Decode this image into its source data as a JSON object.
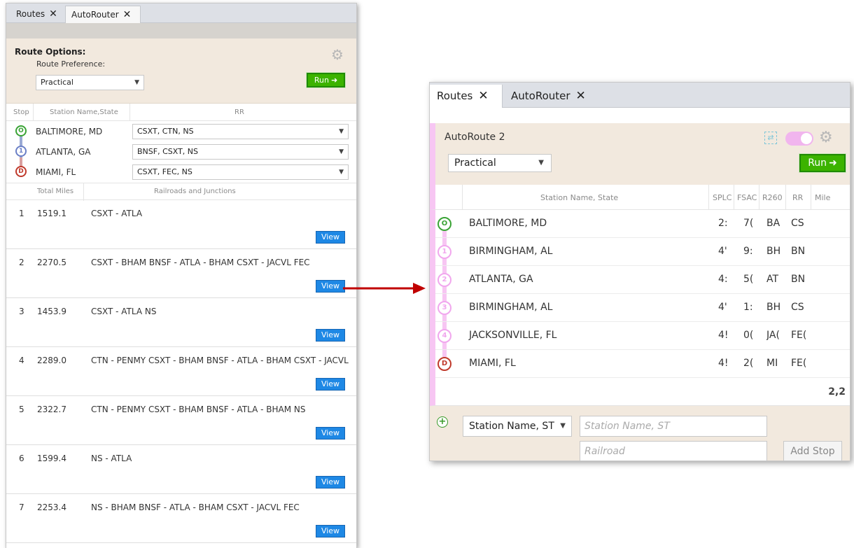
{
  "left": {
    "tabs": [
      {
        "label": "Routes",
        "close": "✕"
      },
      {
        "label": "AutoRouter",
        "close": "✕"
      }
    ],
    "options": {
      "title": "Route Options:",
      "pref_label": "Route Preference:",
      "pref_value": "Practical",
      "run_label": "Run"
    },
    "stop_headers": {
      "stop": "Stop",
      "station": "Station Name,State",
      "rr": "RR"
    },
    "stops": [
      {
        "marker": "O",
        "name": "BALTIMORE, MD",
        "rr": "CSXT, CTN, NS"
      },
      {
        "marker": "1",
        "name": "ATLANTA, GA",
        "rr": "BNSF, CSXT, NS"
      },
      {
        "marker": "D",
        "name": "MIAMI, FL",
        "rr": "CSXT, FEC, NS"
      }
    ],
    "result_headers": {
      "miles": "Total Miles",
      "rr": "Railroads and Junctions"
    },
    "view_label": "View",
    "results": [
      {
        "num": "1",
        "miles": "1519.1",
        "path": "CSXT - ATLA"
      },
      {
        "num": "2",
        "miles": "2270.5",
        "path": "CSXT - BHAM BNSF - ATLA - BHAM CSXT - JACVL FEC"
      },
      {
        "num": "3",
        "miles": "1453.9",
        "path": "CSXT - ATLA NS"
      },
      {
        "num": "4",
        "miles": "2289.0",
        "path": "CTN - PENMY CSXT - BHAM BNSF - ATLA - BHAM CSXT - JACVL"
      },
      {
        "num": "5",
        "miles": "2322.7",
        "path": "CTN - PENMY CSXT - BHAM BNSF - ATLA - BHAM NS"
      },
      {
        "num": "6",
        "miles": "1599.4",
        "path": "NS - ATLA"
      },
      {
        "num": "7",
        "miles": "2253.4",
        "path": "NS - BHAM BNSF - ATLA - BHAM CSXT - JACVL FEC"
      }
    ]
  },
  "right": {
    "tabs": [
      {
        "label": "Routes",
        "close": "✕"
      },
      {
        "label": "AutoRouter",
        "close": "✕"
      }
    ],
    "route_title": "AutoRoute 2",
    "pref_value": "Practical",
    "run_label": "Run",
    "headers": {
      "station": "Station Name, State",
      "splc": "SPLC",
      "fsac": "FSAC",
      "r260": "R260",
      "rr": "RR",
      "miles": "Mile"
    },
    "rows": [
      {
        "marker": "O",
        "name": "BALTIMORE, MD",
        "splc": "2:",
        "fsac": "7(",
        "r260": "BA",
        "rr": "CS"
      },
      {
        "marker": "1",
        "name": "BIRMINGHAM, AL",
        "splc": "4'",
        "fsac": "9:",
        "r260": "BH",
        "rr": "BN"
      },
      {
        "marker": "2",
        "name": "ATLANTA, GA",
        "splc": "4:",
        "fsac": "5(",
        "r260": "AT",
        "rr": "BN"
      },
      {
        "marker": "3",
        "name": "BIRMINGHAM, AL",
        "splc": "4'",
        "fsac": "1:",
        "r260": "BH",
        "rr": "CS"
      },
      {
        "marker": "4",
        "name": "JACKSONVILLE, FL",
        "splc": "4!",
        "fsac": "0(",
        "r260": "JA(",
        "rr": "FE("
      },
      {
        "marker": "D",
        "name": "MIAMI, FL",
        "splc": "4!",
        "fsac": "2(",
        "r260": "MI",
        "rr": "FE("
      }
    ],
    "total_miles": "2,2",
    "add_stop": {
      "type_value": "Station Name, ST",
      "station_placeholder": "Station Name, ST",
      "railroad_placeholder": "Railroad",
      "button_label": "Add Stop"
    }
  },
  "colors": {
    "origin": "#3aa335",
    "intermediate_left": "#6a7fc6",
    "intermediate_right": "#f1a7ee",
    "destination": "#c0392b",
    "run_green": "#3cb300",
    "view_blue": "#1e88e5",
    "arrow_red": "#c00000"
  }
}
